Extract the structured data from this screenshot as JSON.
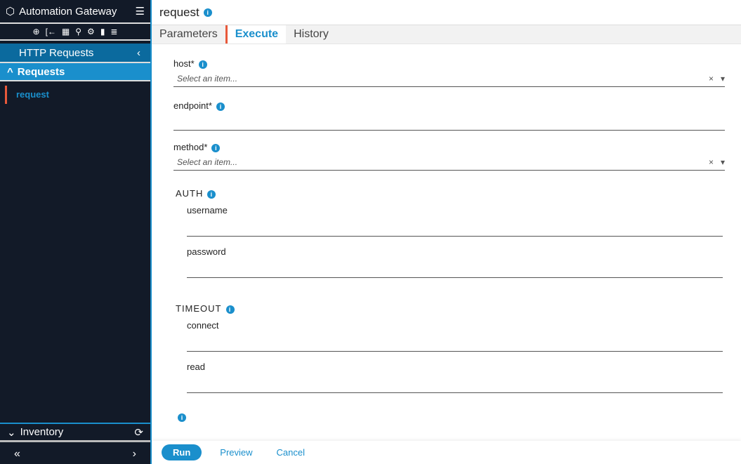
{
  "sidebar": {
    "app_title": "Automation Gateway",
    "section": "HTTP Requests",
    "group": "Requests",
    "items": [
      {
        "label": "request"
      }
    ],
    "inventory": "Inventory",
    "collapse": "«",
    "expand": "›"
  },
  "main": {
    "title": "request",
    "tabs": [
      {
        "label": "Parameters"
      },
      {
        "label": "Execute"
      },
      {
        "label": "History"
      }
    ],
    "fields": {
      "host": {
        "label": "host*",
        "placeholder": "Select an item..."
      },
      "endpoint": {
        "label": "endpoint*"
      },
      "method": {
        "label": "method*",
        "placeholder": "Select an item..."
      }
    },
    "auth": {
      "label": "AUTH",
      "username": "username",
      "password": "password"
    },
    "timeout": {
      "label": "TIMEOUT",
      "connect": "connect",
      "read": "read"
    },
    "buttons": {
      "run": "Run",
      "preview": "Preview",
      "cancel": "Cancel"
    }
  }
}
